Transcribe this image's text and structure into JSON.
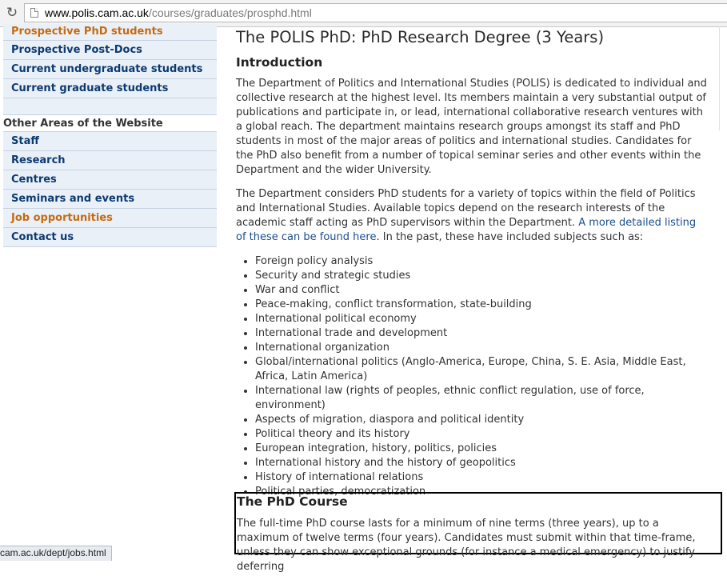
{
  "browser": {
    "url_domain": "www.polis.cam.ac.uk",
    "url_path": "/courses/graduates/prosphd.html",
    "status_url": "cam.ac.uk/dept/jobs.html"
  },
  "sidebar": {
    "items_top": [
      {
        "label": "Prospective PhD students",
        "active": true
      },
      {
        "label": "Prospective Post-Docs"
      },
      {
        "label": "Current undergraduate students"
      },
      {
        "label": "Current graduate students"
      }
    ],
    "heading": "Other Areas of the Website",
    "items_other": [
      {
        "label": "Staff"
      },
      {
        "label": "Research"
      },
      {
        "label": "Centres"
      },
      {
        "label": "Seminars and events"
      },
      {
        "label": "Job opportunities",
        "hover": true
      },
      {
        "label": "Contact us"
      }
    ]
  },
  "main": {
    "title": "The POLIS PhD: PhD Research Degree (3 Years)",
    "intro_heading": "Introduction",
    "intro_p1": "The Department of Politics and International Studies (POLIS) is dedicated to individual and collective research at the highest level. Its members maintain a very substantial output of publications and participate in, or lead, international collaborative research ventures with a global reach. The department maintains research groups amongst its staff and PhD students in most of the major areas of politics and international studies. Candidates for the PhD also benefit from a number of topical seminar series and other events within the Department and the wider University.",
    "intro_p2_before": "The Department considers PhD students for a variety of topics within the field of Politics and International Studies. Available topics depend on the research interests of the academic staff acting as PhD supervisors within the Department. ",
    "intro_p2_link": "A more detailed listing of these can be found here",
    "intro_p2_after": ". In the past, these have included subjects such as:",
    "topics": [
      "Foreign policy analysis",
      "Security and strategic studies",
      "War and conflict",
      "Peace-making, conflict transformation, state-building",
      "International political economy",
      "International trade and development",
      "International organization",
      "Global/international politics (Anglo-America, Europe, China, S. E. Asia, Middle East, Africa, Latin America)",
      "International law (rights of peoples, ethnic conflict regulation, use of force, environment)",
      "Aspects of migration, diaspora and political identity",
      "Political theory and its history",
      "European integration, history, politics, policies",
      "International history and the history of geopolitics",
      "History of international relations",
      "Political parties, democratization"
    ],
    "course_heading": "The PhD Course",
    "course_p1": "The full-time PhD course lasts for a minimum of nine terms (three years), up to a maximum of twelve terms (four years). Candidates must submit within that time-frame, unless they can show exceptional grounds (for instance a medical emergency) to justify deferring"
  },
  "colors": {
    "nav_bg": "#eaf0f8",
    "nav_text": "#0d3a70",
    "nav_active": "#c66b10",
    "link": "#1a4f8e"
  }
}
